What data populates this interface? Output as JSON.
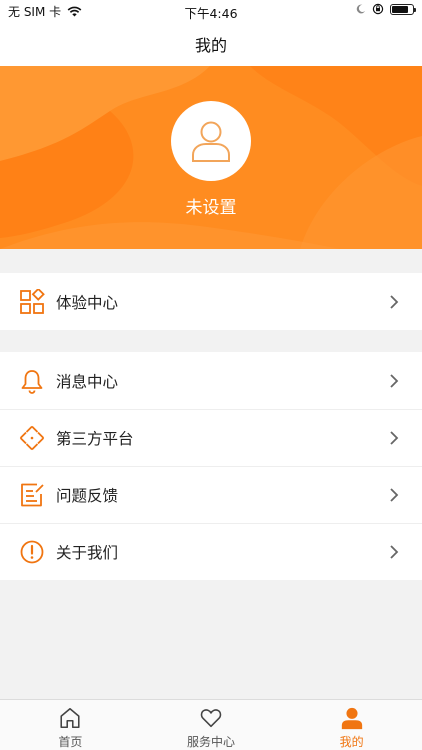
{
  "status_bar": {
    "carrier": "无 SIM 卡",
    "time": "下午4:46"
  },
  "nav": {
    "title": "我的"
  },
  "profile": {
    "username": "未设置"
  },
  "groups": [
    {
      "items": [
        {
          "label": "体验中心",
          "icon": "grid-icon"
        }
      ]
    },
    {
      "items": [
        {
          "label": "消息中心",
          "icon": "bell-icon"
        },
        {
          "label": "第三方平台",
          "icon": "diamond-dots-icon"
        },
        {
          "label": "问题反馈",
          "icon": "edit-note-icon"
        },
        {
          "label": "关于我们",
          "icon": "info-exclamation-icon"
        }
      ]
    }
  ],
  "tab_bar": {
    "tabs": [
      {
        "label": "首页",
        "icon": "home-icon",
        "active": false
      },
      {
        "label": "服务中心",
        "icon": "heart-icon",
        "active": false
      },
      {
        "label": "我的",
        "icon": "person-icon",
        "active": true
      }
    ]
  },
  "colors": {
    "accent": "#f07511",
    "header_orange": "#ff8a1e",
    "background": "#f2f2f2"
  }
}
